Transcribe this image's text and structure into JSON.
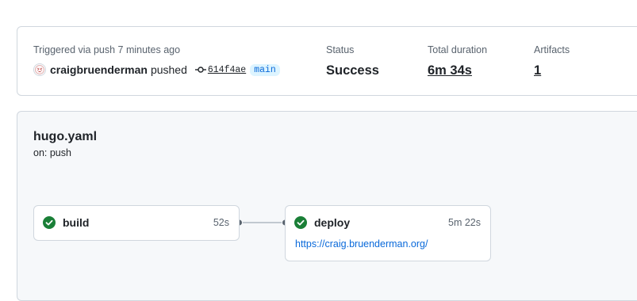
{
  "summary": {
    "trigger_text": "Triggered via push 7 minutes ago",
    "actor": "craigbruenderman",
    "action": "pushed",
    "commit_sha": "614f4ae",
    "branch": "main",
    "status_label": "Status",
    "status_value": "Success",
    "duration_label": "Total duration",
    "duration_value": "6m 34s",
    "artifacts_label": "Artifacts",
    "artifacts_value": "1"
  },
  "workflow": {
    "file_name": "hugo.yaml",
    "trigger": "on: push",
    "jobs": [
      {
        "name": "build",
        "duration": "52s",
        "status": "success"
      },
      {
        "name": "deploy",
        "duration": "5m 22s",
        "status": "success",
        "url": "https://craig.bruenderman.org/"
      }
    ]
  },
  "colors": {
    "success": "#1a7f37",
    "link": "#0969da",
    "branch_bg": "#ddf4ff",
    "panel_bg": "#f6f8fa",
    "border": "#d0d7de"
  },
  "icons": {
    "avatar": "avatar-icon",
    "commit": "git-commit-icon",
    "job_status": "check-circle-fill-icon"
  }
}
